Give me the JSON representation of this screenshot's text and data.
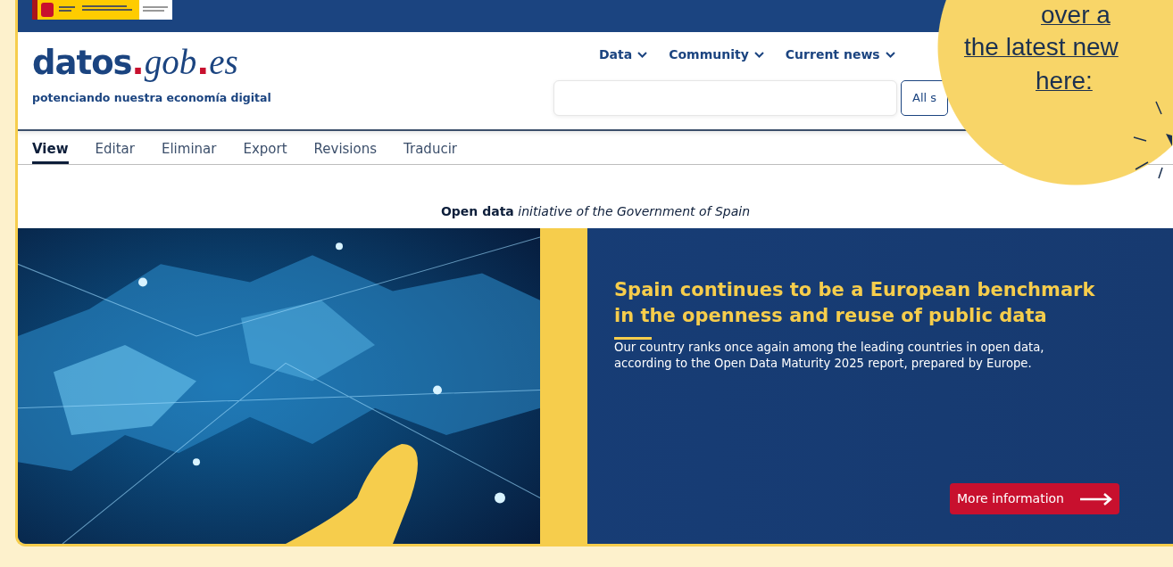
{
  "logo": {
    "parts": [
      {
        "text": "datos",
        "kind": "sans"
      },
      {
        "text": ".",
        "kind": "dot"
      },
      {
        "text": "gob",
        "kind": "serif"
      },
      {
        "text": ".",
        "kind": "dot"
      },
      {
        "text": "es",
        "kind": "serif"
      }
    ],
    "tagline": "potenciando nuestra economía digital"
  },
  "nav": [
    {
      "label": "Data"
    },
    {
      "label": "Community"
    },
    {
      "label": "Current news"
    }
  ],
  "search": {
    "scope_button": "All s"
  },
  "tabs": [
    {
      "label": "View",
      "selected": true
    },
    {
      "label": "Editar",
      "selected": false
    },
    {
      "label": "Eliminar",
      "selected": false
    },
    {
      "label": "Export",
      "selected": false
    },
    {
      "label": "Revisions",
      "selected": false
    },
    {
      "label": "Traducir",
      "selected": false
    }
  ],
  "subtitle": "**Open data** *initiative of the Government of Spain*",
  "hero": {
    "title": "Spain continues to be a European benchmark in the openness and reuse of public data",
    "text": "Our country ranks once again among the leading countries in open data, according to the Open Data Maturity 2025 report, prepared by Europe.",
    "button": "More information"
  },
  "callout": {
    "lines": [
      "over a",
      "the latest new",
      "here:"
    ]
  }
}
